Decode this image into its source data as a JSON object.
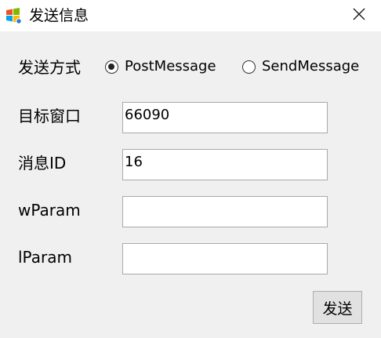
{
  "window": {
    "title": "发送信息"
  },
  "form": {
    "send_mode_label": "发送方式",
    "send_modes": [
      {
        "label": "PostMessage",
        "selected": true
      },
      {
        "label": "SendMessage",
        "selected": false
      }
    ],
    "target_window_label": "目标窗口",
    "target_window_value": "66090",
    "message_id_label": "消息ID",
    "message_id_value": "16",
    "wparam_label": "wParam",
    "wparam_value": "",
    "lparam_label": "lParam",
    "lparam_value": ""
  },
  "buttons": {
    "send_label": "发送"
  },
  "icons": {
    "app": "windows-flag-icon",
    "close": "close-icon"
  }
}
